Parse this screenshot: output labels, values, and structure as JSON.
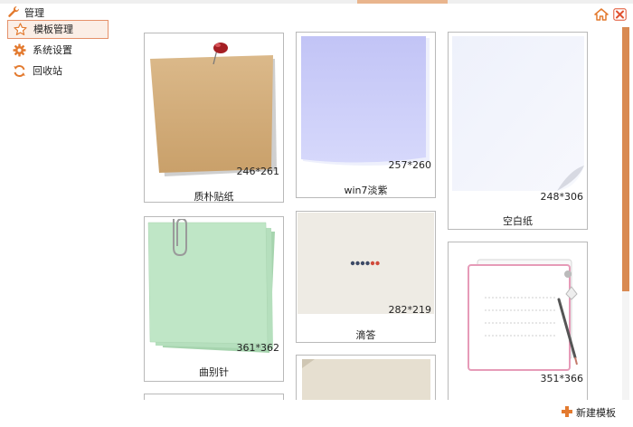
{
  "window": {
    "title": "管理"
  },
  "sidebar": {
    "items": [
      {
        "label": "模板管理",
        "active": true,
        "icon": "star-icon"
      },
      {
        "label": "系统设置",
        "active": false,
        "icon": "gear-icon"
      },
      {
        "label": "回收站",
        "active": false,
        "icon": "recycle-icon"
      }
    ]
  },
  "templates": [
    {
      "name": "质朴贴纸",
      "size": "246*261"
    },
    {
      "name": "win7淡紫",
      "size": "257*260"
    },
    {
      "name": "空白纸",
      "size": "248*306"
    },
    {
      "name": "曲别针",
      "size": "361*362"
    },
    {
      "name": "滴答",
      "size": "282*219"
    },
    {
      "name": "",
      "size": "351*366"
    }
  ],
  "footer": {
    "new_template_label": "新建模板"
  },
  "colors": {
    "accent": "#e37a2f",
    "active_bg": "#fbeee6",
    "active_border": "#e5916a",
    "scroll_thumb": "#d98a52",
    "close_red": "#e0502f"
  }
}
